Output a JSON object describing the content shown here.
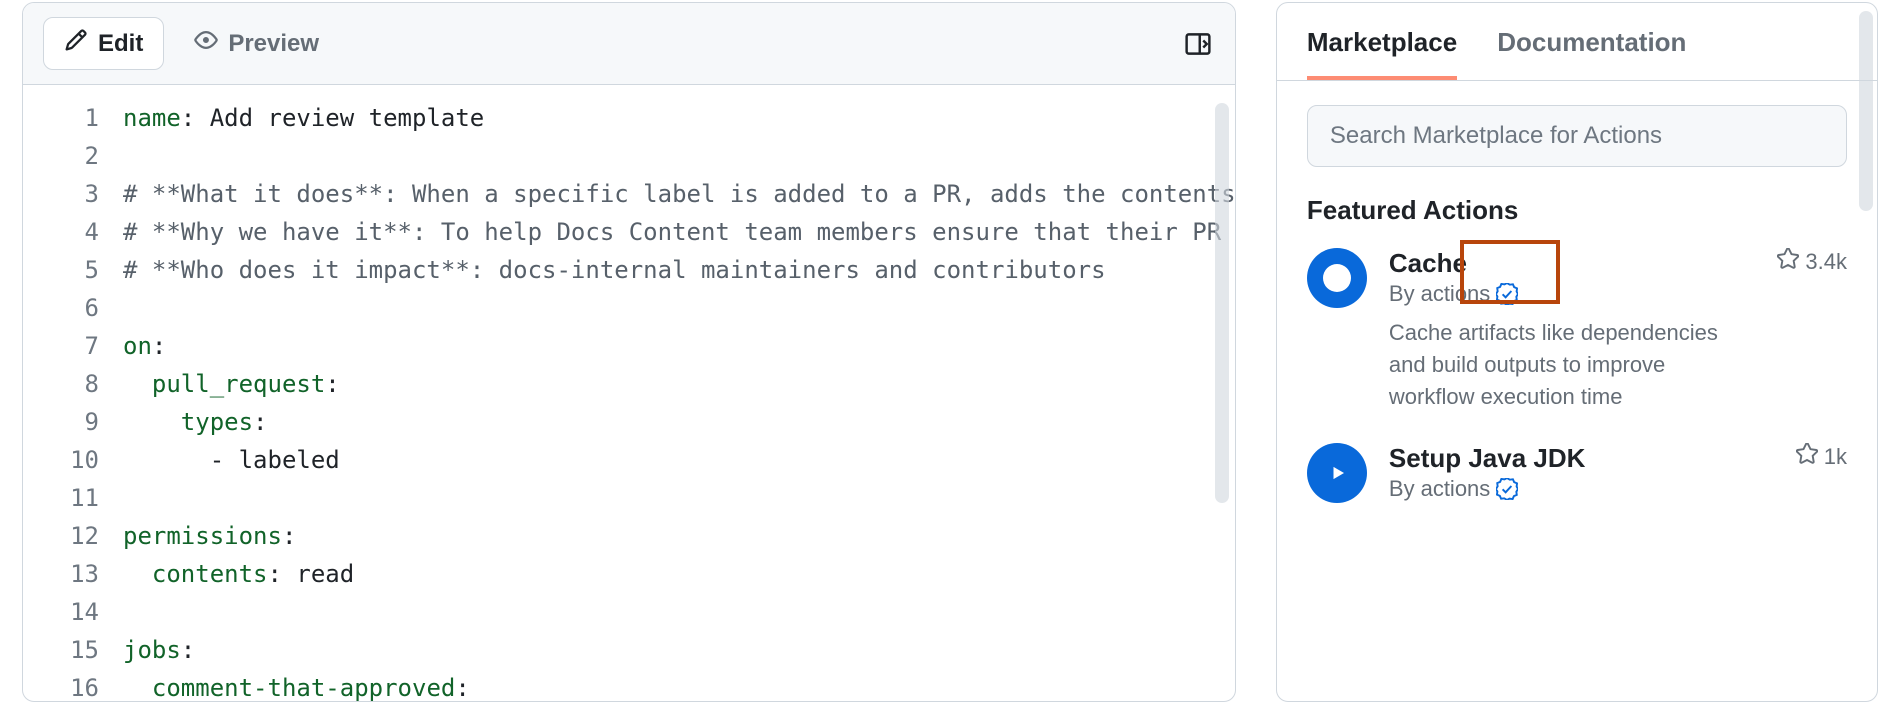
{
  "editor": {
    "tabs": {
      "edit": "Edit",
      "preview": "Preview"
    },
    "lines": [
      {
        "n": 1,
        "segments": [
          {
            "t": "name",
            "c": "key"
          },
          {
            "t": ":",
            "c": "punct"
          },
          {
            "t": " Add review template",
            "c": "str"
          }
        ]
      },
      {
        "n": 2,
        "segments": []
      },
      {
        "n": 3,
        "segments": [
          {
            "t": "# **What it does**: When a specific label is added to a PR, adds the contents o",
            "c": "comment"
          }
        ]
      },
      {
        "n": 4,
        "segments": [
          {
            "t": "# **Why we have it**: To help Docs Content team members ensure that their PR is",
            "c": "comment"
          }
        ]
      },
      {
        "n": 5,
        "segments": [
          {
            "t": "# **Who does it impact**: docs-internal maintainers and contributors",
            "c": "comment"
          }
        ]
      },
      {
        "n": 6,
        "segments": []
      },
      {
        "n": 7,
        "segments": [
          {
            "t": "on",
            "c": "key"
          },
          {
            "t": ":",
            "c": "punct"
          }
        ]
      },
      {
        "n": 8,
        "segments": [
          {
            "t": "  ",
            "c": "str"
          },
          {
            "t": "pull_request",
            "c": "key"
          },
          {
            "t": ":",
            "c": "punct"
          }
        ]
      },
      {
        "n": 9,
        "segments": [
          {
            "t": "    ",
            "c": "str"
          },
          {
            "t": "types",
            "c": "key"
          },
          {
            "t": ":",
            "c": "punct"
          }
        ]
      },
      {
        "n": 10,
        "segments": [
          {
            "t": "      - labeled",
            "c": "str"
          }
        ]
      },
      {
        "n": 11,
        "segments": []
      },
      {
        "n": 12,
        "segments": [
          {
            "t": "permissions",
            "c": "key"
          },
          {
            "t": ":",
            "c": "punct"
          }
        ]
      },
      {
        "n": 13,
        "segments": [
          {
            "t": "  ",
            "c": "str"
          },
          {
            "t": "contents",
            "c": "key"
          },
          {
            "t": ":",
            "c": "punct"
          },
          {
            "t": " read",
            "c": "str"
          }
        ]
      },
      {
        "n": 14,
        "segments": []
      },
      {
        "n": 15,
        "segments": [
          {
            "t": "jobs",
            "c": "key"
          },
          {
            "t": ":",
            "c": "punct"
          }
        ]
      },
      {
        "n": 16,
        "segments": [
          {
            "t": "  ",
            "c": "str"
          },
          {
            "t": "comment-that-approved",
            "c": "key"
          },
          {
            "t": ":",
            "c": "punct"
          }
        ]
      }
    ]
  },
  "sidebar": {
    "tabs": {
      "marketplace": "Marketplace",
      "documentation": "Documentation"
    },
    "search_placeholder": "Search Marketplace for Actions",
    "section_heading": "Featured Actions",
    "actions": [
      {
        "title": "Cache",
        "by_prefix": "By ",
        "by_author": "actions",
        "stars": "3.4k",
        "desc": "Cache artifacts like dependencies and build outputs to improve workflow execution time"
      },
      {
        "title": "Setup Java JDK",
        "by_prefix": "By ",
        "by_author": "actions",
        "stars": "1k",
        "desc": ""
      }
    ]
  }
}
